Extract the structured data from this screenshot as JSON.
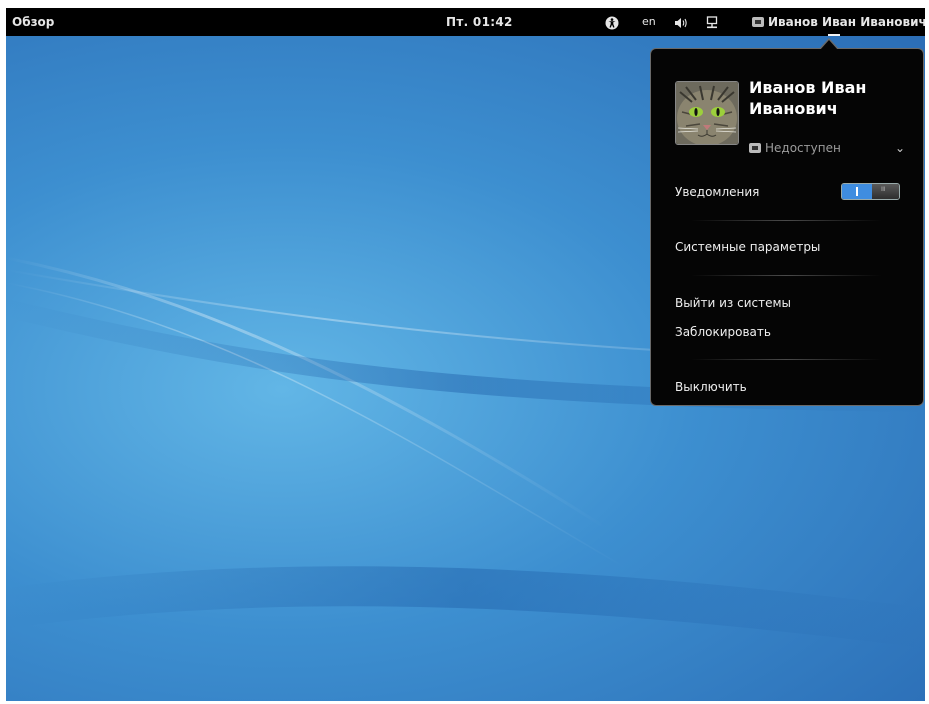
{
  "topbar": {
    "activities": "Обзор",
    "clock": "Пт. 01:42",
    "language": "en",
    "user_name": "Иванов Иван Иванович"
  },
  "user_menu": {
    "full_name": "Иванов Иван Иванович",
    "status": "Недоступен",
    "notifications_label": "Уведомления",
    "notifications_enabled": true,
    "settings_label": "Системные параметры",
    "logout_label": "Выйти из системы",
    "lock_label": "Заблокировать",
    "power_off_label": "Выключить"
  },
  "icons": {
    "accessibility": "accessibility-icon",
    "volume": "volume-icon",
    "network": "network-icon",
    "chat_status": "chat-status-icon",
    "chevron": "chevron-down-icon"
  },
  "colors": {
    "desktop": "#3d8fd0",
    "toggle_on": "#3f8de0",
    "topbar": "#000000"
  }
}
